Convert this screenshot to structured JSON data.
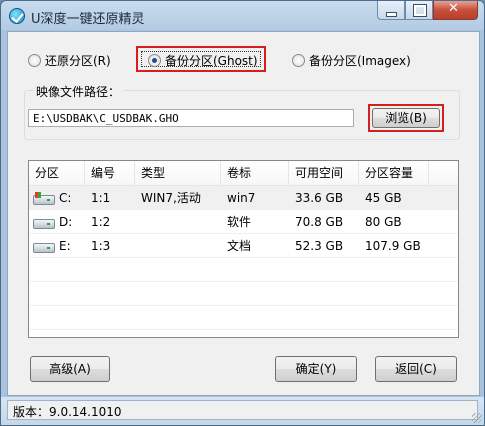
{
  "window": {
    "title": "U深度一键还原精灵"
  },
  "radios": {
    "restore": "还原分区(R)",
    "backup_ghost": "备份分区(Ghost)",
    "backup_imagex": "备份分区(Imagex)"
  },
  "image_path": {
    "label": "映像文件路径：",
    "value": "E:\\USDBAK\\C_USDBAK.GHO"
  },
  "browse_button": "浏览(B)",
  "partition_table": {
    "headers": [
      "分区",
      "编号",
      "类型",
      "卷标",
      "可用空间",
      "分区容量"
    ],
    "rows": [
      {
        "drive": "C:",
        "number": "1:1",
        "type": "WIN7,活动",
        "label": "win7",
        "free": "33.6 GB",
        "capacity": "45 GB"
      },
      {
        "drive": "D:",
        "number": "1:2",
        "type": "",
        "label": "软件",
        "free": "70.8 GB",
        "capacity": "80 GB"
      },
      {
        "drive": "E:",
        "number": "1:3",
        "type": "",
        "label": "文档",
        "free": "52.3 GB",
        "capacity": "107.9 GB"
      }
    ]
  },
  "buttons": {
    "advanced": "高级(A)",
    "ok": "确定(Y)",
    "back": "返回(C)"
  },
  "status": {
    "version": "版本：9.0.14.1010"
  },
  "colors": {
    "highlight_border": "#d41f1f",
    "title_gradient": "#b3cbe3"
  }
}
